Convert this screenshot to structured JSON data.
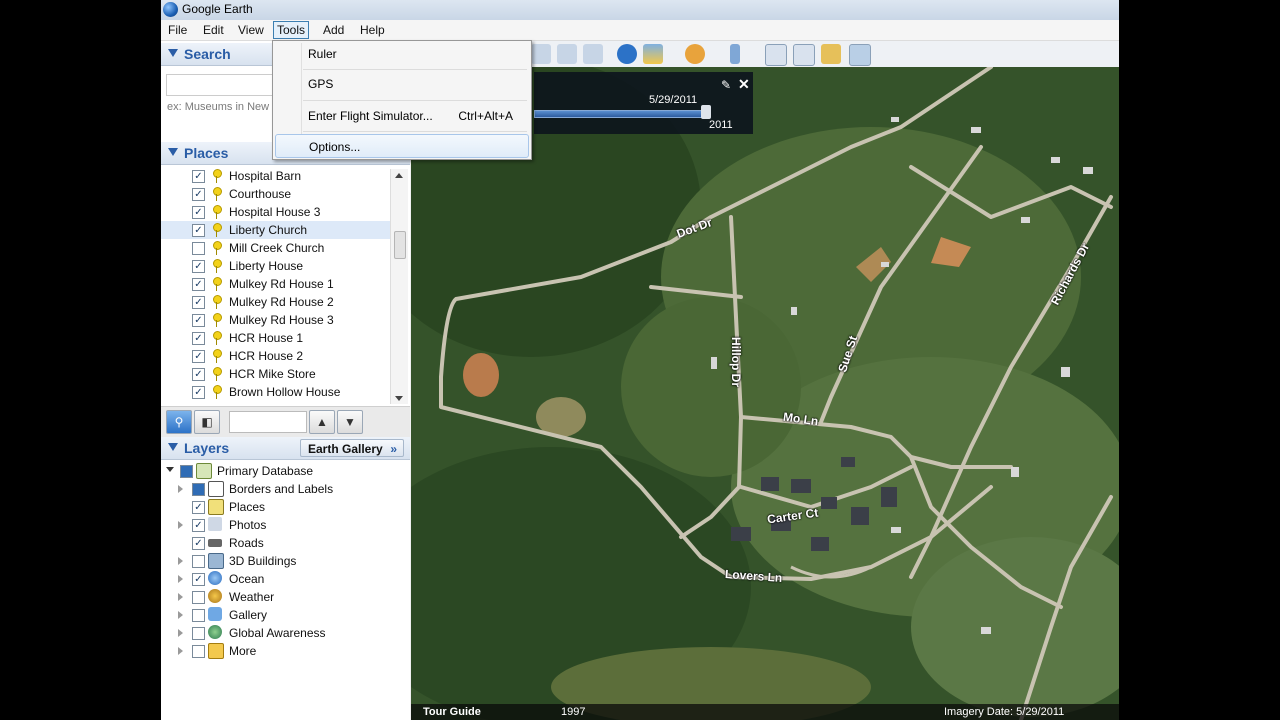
{
  "app": {
    "title": "Google Earth"
  },
  "menubar": [
    "File",
    "Edit",
    "View",
    "Tools",
    "Add",
    "Help"
  ],
  "tools_menu": {
    "items": [
      {
        "label": "Ruler",
        "shortcut": ""
      },
      {
        "label": "GPS",
        "shortcut": ""
      },
      {
        "label": "Enter Flight Simulator...",
        "shortcut": "Ctrl+Alt+A"
      },
      {
        "label": "Options...",
        "shortcut": ""
      }
    ]
  },
  "search": {
    "title": "Search",
    "value": "",
    "hint": "ex: Museums in New Y"
  },
  "places": {
    "title": "Places",
    "items": [
      {
        "label": "Hospital Barn",
        "checked": true
      },
      {
        "label": "Courthouse",
        "checked": true
      },
      {
        "label": "Hospital House 3",
        "checked": true
      },
      {
        "label": "Liberty Church",
        "checked": true,
        "selected": true
      },
      {
        "label": "Mill Creek Church",
        "checked": false
      },
      {
        "label": "Liberty House",
        "checked": true
      },
      {
        "label": "Mulkey Rd House 1",
        "checked": true
      },
      {
        "label": "Mulkey Rd House 2",
        "checked": true
      },
      {
        "label": "Mulkey Rd House 3",
        "checked": true
      },
      {
        "label": "HCR House 1",
        "checked": true
      },
      {
        "label": "HCR House 2",
        "checked": true
      },
      {
        "label": "HCR Mike Store",
        "checked": true
      },
      {
        "label": "Brown Hollow House",
        "checked": true
      }
    ]
  },
  "layers": {
    "title": "Layers",
    "gallery_button": "Earth Gallery",
    "root": "Primary Database",
    "items": [
      {
        "label": "Borders and Labels",
        "checked": true,
        "icon": "flag-icon"
      },
      {
        "label": "Places",
        "checked": true,
        "icon": "places-icon"
      },
      {
        "label": "Photos",
        "checked": true,
        "icon": "photo-icon"
      },
      {
        "label": "Roads",
        "checked": true,
        "icon": "road-icon"
      },
      {
        "label": "3D Buildings",
        "checked": false,
        "icon": "building-icon"
      },
      {
        "label": "Ocean",
        "checked": true,
        "icon": "ocean-icon"
      },
      {
        "label": "Weather",
        "checked": false,
        "icon": "weather-icon"
      },
      {
        "label": "Gallery",
        "checked": false,
        "icon": "gallery-icon"
      },
      {
        "label": "Global Awareness",
        "checked": false,
        "icon": "globe-icon"
      },
      {
        "label": "More",
        "checked": false,
        "icon": "folder-icon"
      }
    ]
  },
  "timeslider": {
    "date": "5/29/2011",
    "year": "2011"
  },
  "map_labels": [
    "Dot Dr",
    "Hillop Dr",
    "Sue St",
    "Richards Dr",
    "Mo Ln",
    "Carter Ct",
    "Lovers Ln"
  ],
  "statusbar": {
    "tour": "Tour Guide",
    "year": "1997",
    "imagery": "Imagery Date: 5/29/2011"
  }
}
